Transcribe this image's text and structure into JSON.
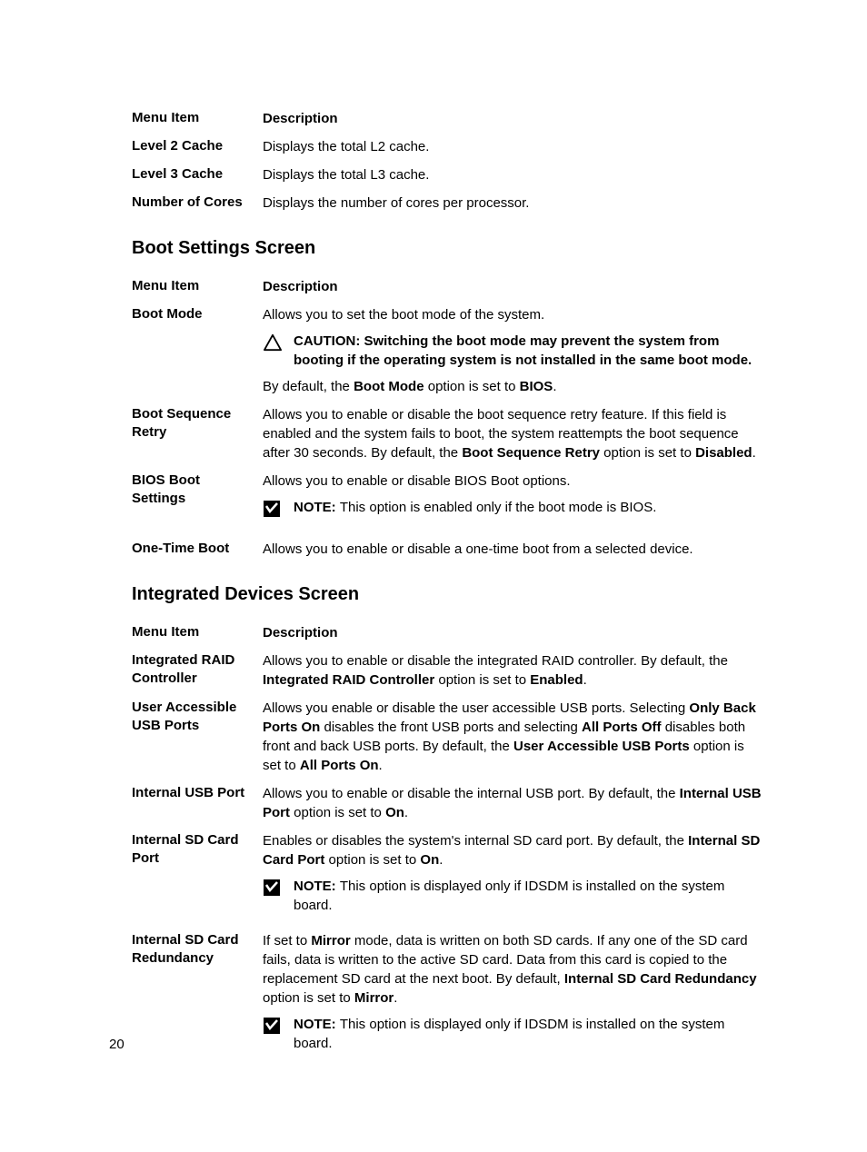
{
  "table1": {
    "header": {
      "c1": "Menu Item",
      "c2": "Description"
    },
    "rows": [
      {
        "c1": "Level 2 Cache",
        "c2": "Displays the total L2 cache."
      },
      {
        "c1": "Level 3 Cache",
        "c2": "Displays the total L3 cache."
      },
      {
        "c1": "Number of Cores",
        "c2": "Displays the number of cores per processor."
      }
    ]
  },
  "section2": {
    "title": "Boot Settings Screen",
    "header": {
      "c1": "Menu Item",
      "c2": "Description"
    },
    "rows": {
      "boot_mode": {
        "label": "Boot Mode",
        "p1": "Allows you to set the boot mode of the system.",
        "caution_lead": "CAUTION: ",
        "caution_text": "Switching the boot mode may prevent the system from booting if the operating system is not installed in the same boot mode.",
        "p2_pre": "By default, the ",
        "p2_b1": "Boot Mode",
        "p2_mid": " option is set to ",
        "p2_b2": "BIOS",
        "p2_post": "."
      },
      "boot_seq_retry": {
        "label": "Boot Sequence Retry",
        "p_pre": "Allows you to enable or disable the boot sequence retry feature. If this field is enabled and the system fails to boot, the system reattempts the boot sequence after 30 seconds. By default, the ",
        "b1": "Boot Sequence Retry",
        "mid": " option is set to ",
        "b2": "Disabled",
        "post": "."
      },
      "bios_boot": {
        "label": "BIOS Boot Settings",
        "p1": "Allows you to enable or disable BIOS Boot options.",
        "note_lead": "NOTE: ",
        "note_text": "This option is enabled only if the boot mode is BIOS."
      },
      "one_time": {
        "label": "One-Time Boot",
        "p1": "Allows you to enable or disable a one-time boot from a selected device."
      }
    }
  },
  "section3": {
    "title": "Integrated Devices Screen",
    "header": {
      "c1": "Menu Item",
      "c2": "Description"
    },
    "rows": {
      "raid": {
        "label": "Integrated RAID Controller",
        "pre": "Allows you to enable or disable the integrated RAID controller. By default, the ",
        "b1": "Integrated RAID Controller",
        "mid": " option is set to ",
        "b2": "Enabled",
        "post": "."
      },
      "usb_ports": {
        "label": "User Accessible USB Ports",
        "pre": "Allows you enable or disable the user accessible USB ports. Selecting ",
        "b1": "Only Back Ports On",
        "mid1": " disables the front USB ports and selecting ",
        "b2": "All Ports Off",
        "mid2": " disables both front and back USB ports. By default, the ",
        "b3": "User Accessible USB Ports",
        "mid3": " option is set to ",
        "b4": "All Ports On",
        "post": "."
      },
      "internal_usb": {
        "label": "Internal USB Port",
        "pre": "Allows you to enable or disable the internal USB port. By default, the ",
        "b1": "Internal USB Port",
        "mid": " option is set to ",
        "b2": "On",
        "post": "."
      },
      "sd_port": {
        "label": "Internal SD Card Port",
        "pre": "Enables or disables the system's internal SD card port. By default, the ",
        "b1": "Internal SD Card Port",
        "mid": " option is set to ",
        "b2": "On",
        "post": ".",
        "note_lead": "NOTE: ",
        "note_text": "This option is displayed only if IDSDM is installed on the system board."
      },
      "sd_redundancy": {
        "label": "Internal SD Card Redundancy",
        "pre": "If set to ",
        "b1": "Mirror",
        "mid1": " mode, data is written on both SD cards. If any one of the SD card fails, data is written to the active SD card. Data from this card is copied to the replacement SD card at the next boot. By default, ",
        "b2": "Internal SD Card Redundancy",
        "mid2": " option is set to ",
        "b3": "Mirror",
        "post": ".",
        "note_lead": "NOTE: ",
        "note_text": "This option is displayed only if IDSDM is installed on the system board."
      }
    }
  },
  "page_number": "20"
}
